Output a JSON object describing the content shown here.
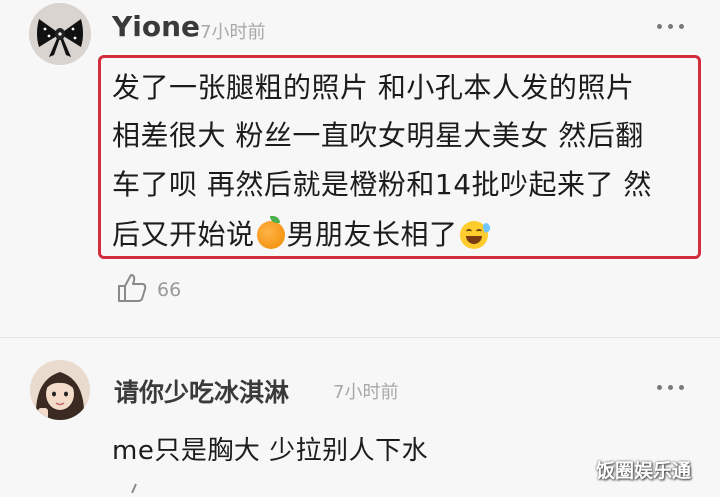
{
  "comments": [
    {
      "username": "Yione",
      "time": "7小时前",
      "lines": [
        "发了一张腿粗的照片  和小孔本人发的照片",
        "相差很大  粉丝一直吹女明星大美女  然后翻",
        "车了呗  再然后就是橙粉和14批吵起来了  然",
        "后又开始说",
        "男朋友长相了"
      ],
      "like_count": "66",
      "icons": [
        "orange-emoji-icon",
        "laugh-sweat-emoji-icon",
        "thumbs-up-icon",
        "more-dots-icon"
      ]
    },
    {
      "username": "请你少吃冰淇淋",
      "time": "7小时前",
      "lines": [
        "me只是胸大 少拉别人下水"
      ],
      "icons": [
        "more-dots-icon"
      ]
    }
  ],
  "watermark": "饭圈娱乐通",
  "colors": {
    "highlight_border": "#d32c3c",
    "time_text": "#a8a8a8",
    "background": "#f7f7f7"
  }
}
